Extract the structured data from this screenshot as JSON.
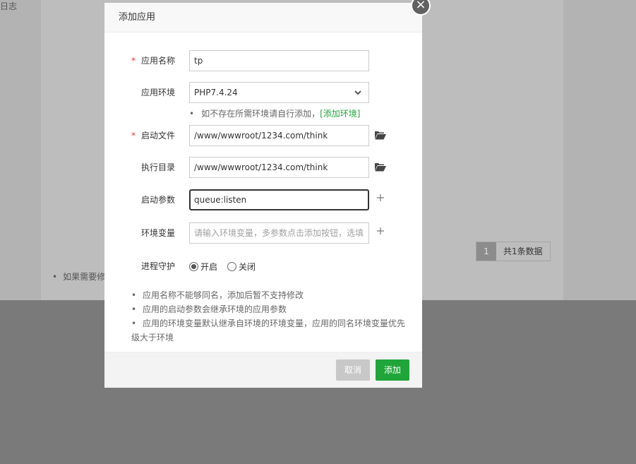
{
  "background": {
    "log_label": "日志",
    "note": "如果需要修",
    "pager": {
      "current": "1",
      "total": "共1条数据"
    }
  },
  "modal": {
    "title": "添加应用",
    "close_label": "×",
    "fields": {
      "app_name": {
        "label": "应用名称",
        "value": "tp"
      },
      "app_env": {
        "label": "应用环境",
        "value": "PHP7.4.24"
      },
      "start_file": {
        "label": "启动文件",
        "value": "/www/wwwroot/1234.com/think"
      },
      "exec_dir": {
        "label": "执行目录",
        "value": "/www/wwwroot/1234.com/think"
      },
      "start_params": {
        "label": "启动参数",
        "value": "queue:listen"
      },
      "env_vars": {
        "label": "环境变量",
        "placeholder": "请输入环境变量，多参数点击添加按钮，选填"
      },
      "daemon": {
        "label": "进程守护",
        "on_label": "开启",
        "off_label": "关闭"
      }
    },
    "env_hint": {
      "text": "如不存在所需环境请自行添加，",
      "link": "[添加环境]"
    },
    "notes": [
      "应用名称不能够同名，添加后暂不支持修改",
      "应用的启动参数会继承环境的应用参数",
      "应用的环境变量默认继承自环境的环境变量，应用的同名环境变量优先级大于环境"
    ],
    "buttons": {
      "cancel": "取消",
      "add": "添加"
    }
  }
}
